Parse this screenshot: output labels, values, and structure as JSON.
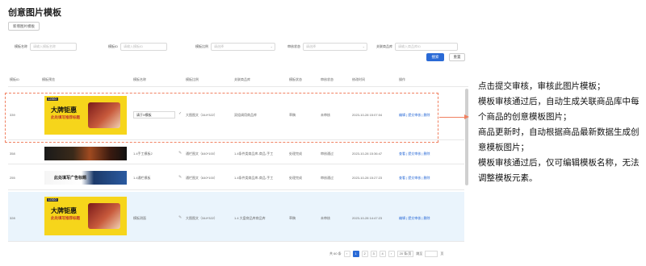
{
  "page": {
    "title": "创意图片模板",
    "new_button": "新增图片模板"
  },
  "filters": {
    "items": [
      {
        "label": "模板名称",
        "placeholder": "请输入模板名称"
      },
      {
        "label": "模板ID",
        "placeholder": "请输入模板ID"
      },
      {
        "label": "模板比例",
        "placeholder": "请选择"
      },
      {
        "label": "审核状态",
        "placeholder": "请选择"
      },
      {
        "label": "关联商品库",
        "placeholder": "请输入商品库ID"
      }
    ],
    "search": "搜索",
    "reset": "重置"
  },
  "table": {
    "headers": [
      "模板ID",
      "模板预览",
      "模板名称",
      "模板比例",
      "关联商品库",
      "模板状态",
      "审核状态",
      "修改时间",
      "操作"
    ],
    "rows": [
      {
        "id": "339",
        "name": "请于X模板",
        "ratio": "大图图文（344*322）",
        "lib": "双组调用商品库",
        "status": "草稿",
        "review": "未审核",
        "time": "2023-10-28 15:07:04",
        "ops": "编辑 | 提交审核 | 删除",
        "thumb_title": "大牌钜惠",
        "thumb_sub": "此处填写推荐标题",
        "thumb_logo": "LOGO"
      },
      {
        "id": "358",
        "name": "1.4手工模板2",
        "ratio": "通栏图文（640*100）",
        "lib": "1.4条件类商品库-商品-手工",
        "status": "处理完成",
        "review": "审核通过",
        "time": "2023-10-28 15:36:47",
        "ops": "查看 | 提交审核 | 删除"
      },
      {
        "id": "255",
        "name": "1.4通栏模板",
        "ratio": "通栏图文（640*100）",
        "lib": "1.4条件类商品库-商品-手工",
        "status": "处理完成",
        "review": "审核通过",
        "time": "2023-10-28 15:27:23",
        "ops": "查看 | 提交审核 | 删除",
        "thumb_text": "此处填写广告标题"
      },
      {
        "id": "328",
        "name": "模板测面",
        "ratio": "大图图文（344*322）",
        "lib": "1.4 大盘商品库商品库",
        "status": "草稿",
        "review": "未审核",
        "time": "2023-10-28 14:47:23",
        "ops": "编辑 | 提交审核 | 删除",
        "thumb_title": "大牌钜惠",
        "thumb_sub": "此处填写推荐标题",
        "thumb_logo": "LOGO"
      }
    ]
  },
  "pagination": {
    "total": "共 60 条",
    "pages": [
      "1",
      "2",
      "3",
      "4"
    ],
    "prev": "‹",
    "next": "›",
    "size": "20 条/页",
    "goto_label": "跳至",
    "goto_suffix": "页"
  },
  "annotation": {
    "lines": [
      "点击提交审核，审核此图片模板；",
      "模板审核通过后，自动生成关联商品库中每个商品的创意模板图片；",
      "商品更新时，自动根据商品最新数据生成创意模板图片；",
      "模板审核通过后，仅可编辑模板名称，无法调整模板元素。"
    ]
  },
  "colors": {
    "primary": "#2a6ad6",
    "highlight": "#f08060",
    "row_highlight": "#eaf4fc"
  }
}
